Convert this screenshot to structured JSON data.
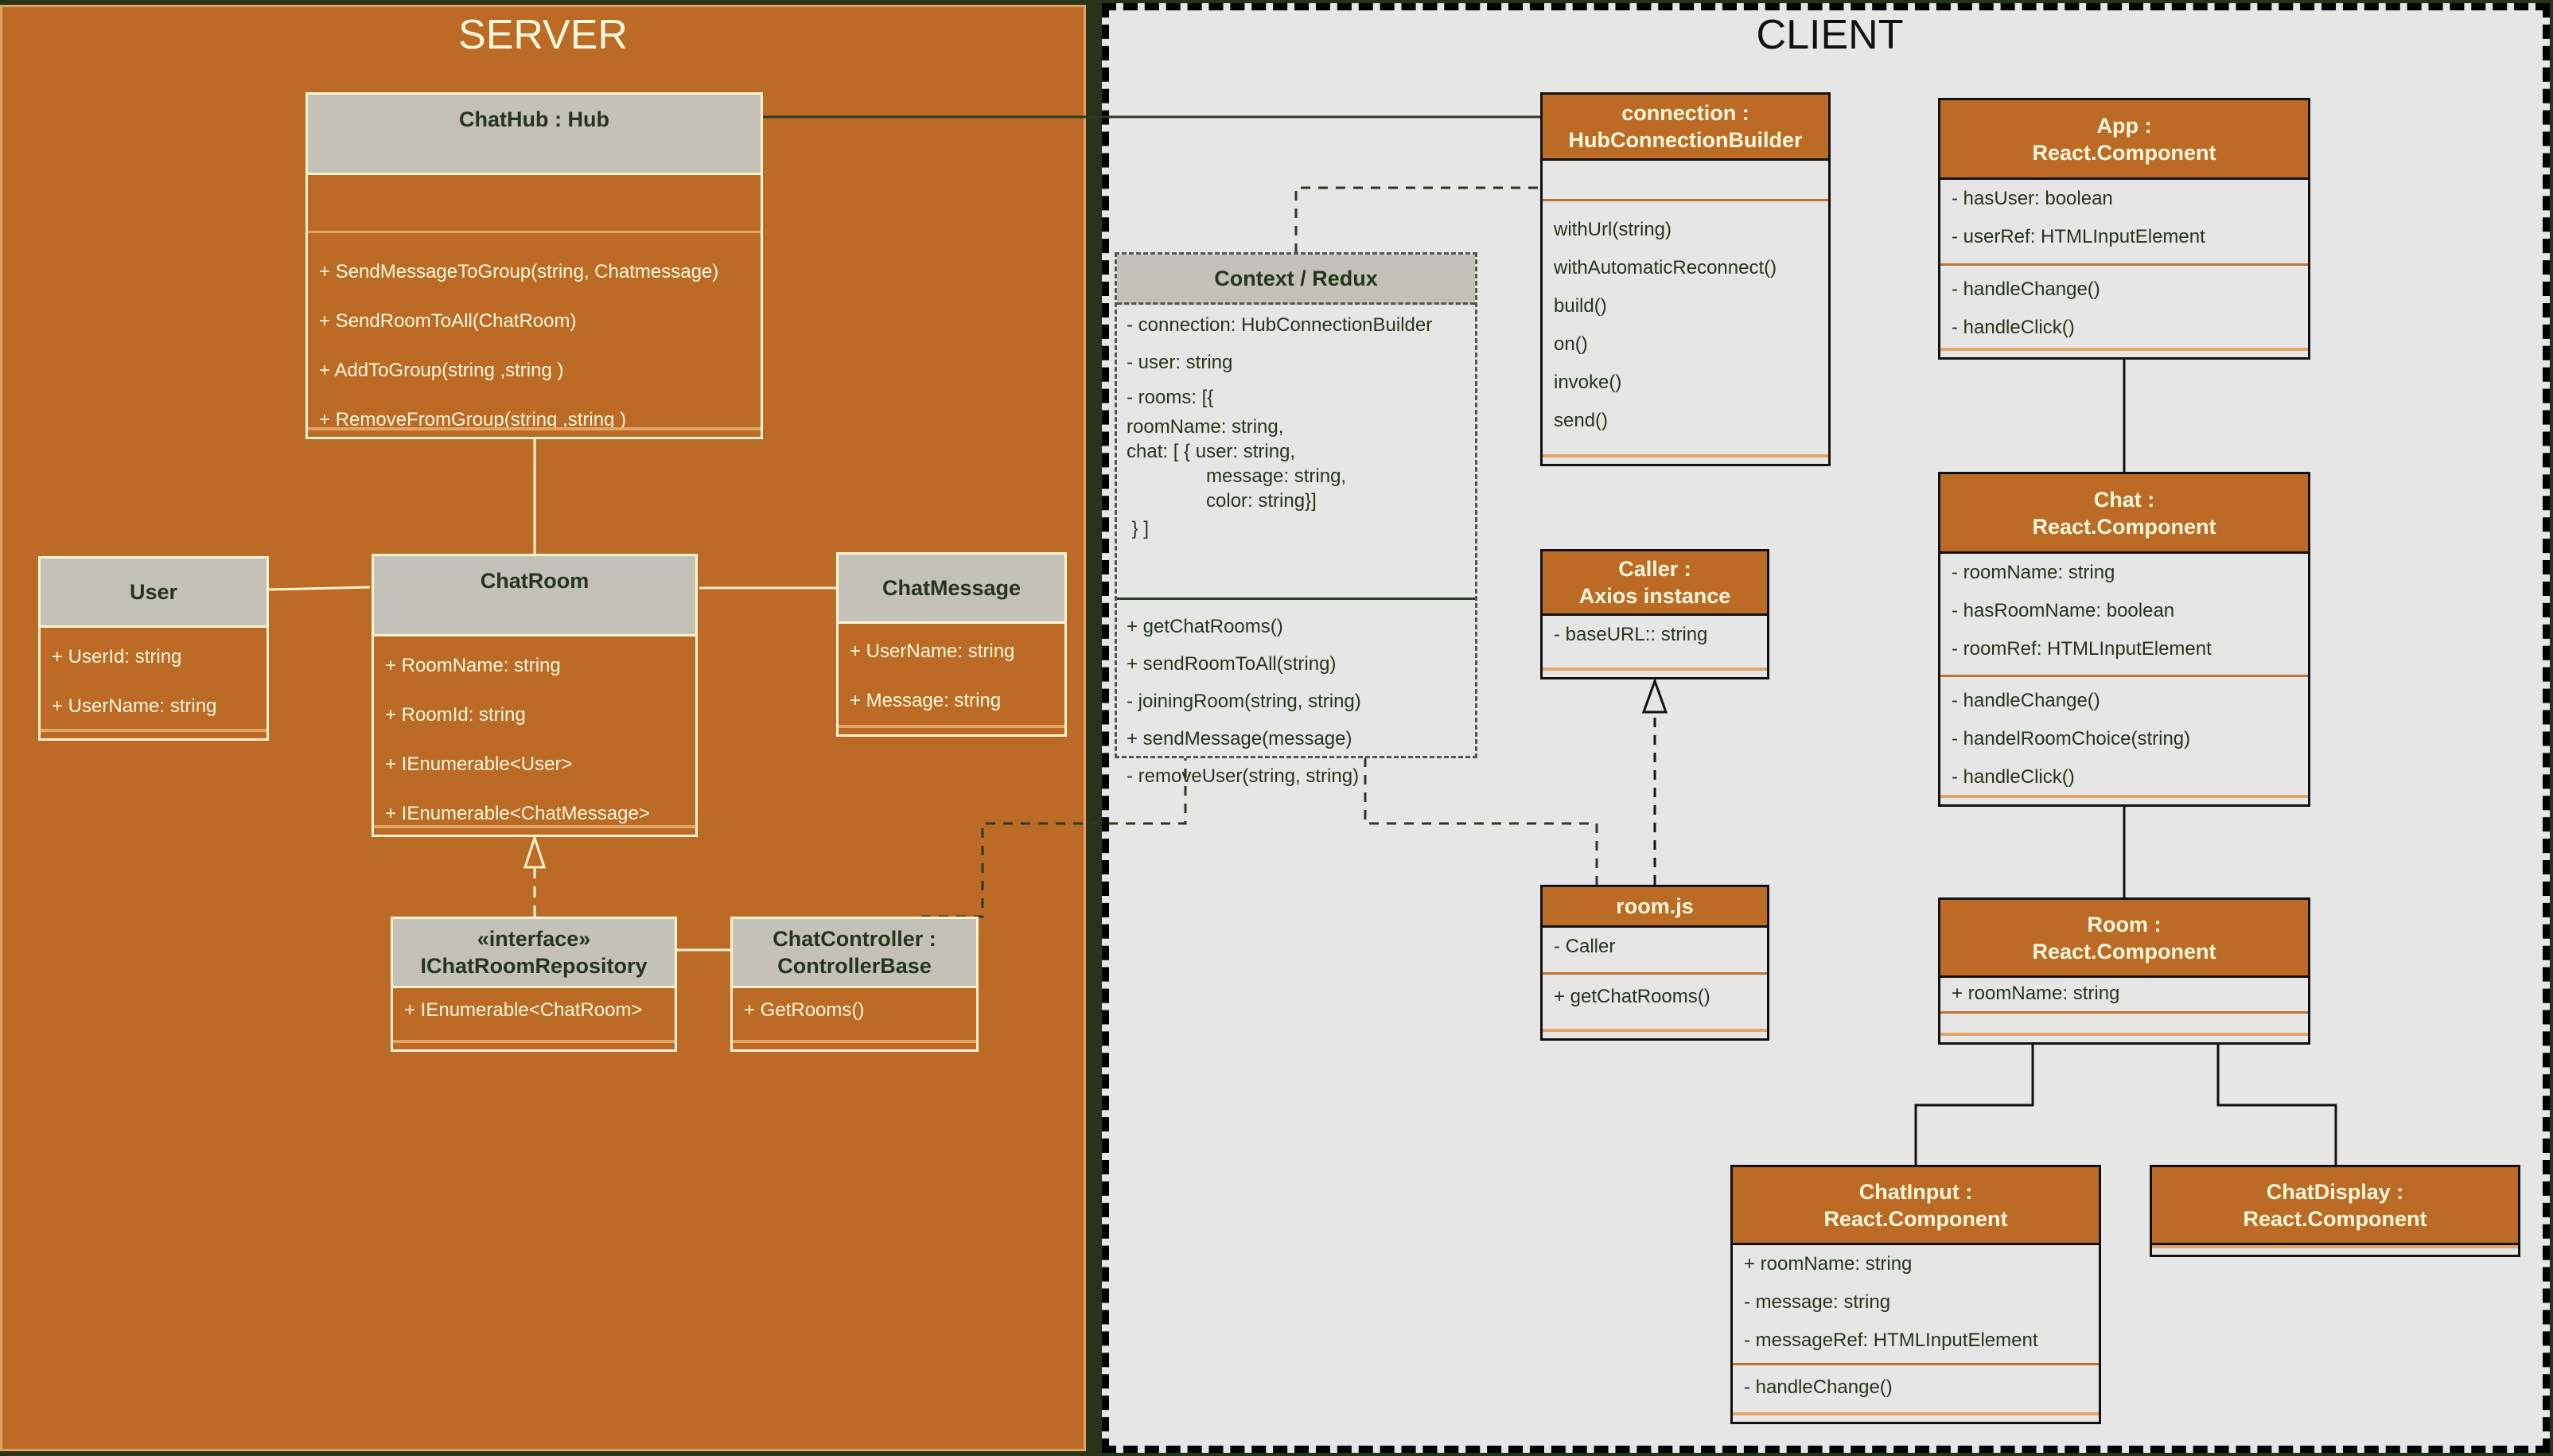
{
  "panels": {
    "server": {
      "title": "SERVER",
      "background": "#bb6b25"
    },
    "client": {
      "title": "CLIENT",
      "background": "#e6e6e6"
    }
  },
  "colors": {
    "accent_orange": "#bb6b25",
    "header_gray": "#c4c1b9",
    "text_dark": "#25351b",
    "text_cream": "#fff8dc",
    "frame": "#283419"
  },
  "server_classes": {
    "chathub": {
      "title": "ChatHub : Hub",
      "attributes": [],
      "methods": [
        "+ SendMessageToGroup(string, Chatmessage)",
        "+ SendRoomToAll(ChatRoom)",
        "+ AddToGroup(string ,string )",
        "+ RemoveFromGroup(string ,string )"
      ]
    },
    "user": {
      "title": "User",
      "attributes": [
        "+ UserId: string",
        "+ UserName: string"
      ]
    },
    "chatroom": {
      "title": "ChatRoom",
      "attributes": [
        "+ RoomName: string",
        "+ RoomId: string",
        "+ IEnumerable<User>",
        "+ IEnumerable<ChatMessage>"
      ]
    },
    "chatmessage": {
      "title": "ChatMessage",
      "attributes": [
        "+ UserName: string",
        "+ Message: string"
      ]
    },
    "ichatroomrepository": {
      "stereotype": "«interface»",
      "title": "IChatRoomRepository",
      "attributes": [
        "+ IEnumerable<ChatRoom>"
      ]
    },
    "chatcontroller": {
      "title_line1": "ChatController :",
      "title_line2": "ControllerBase",
      "attributes": [
        "+ GetRooms()"
      ]
    }
  },
  "client_classes": {
    "context": {
      "title": "Context / Redux",
      "attributes": [
        "- connection: HubConnectionBuilder",
        "- user: string",
        "- rooms: [{",
        "roomName: string,",
        "chat: [ { user: string,",
        "               message: string,",
        "               color: string}]",
        " } ]"
      ],
      "methods": [
        "+ getChatRooms()",
        "+ sendRoomToAll(string)",
        "- joiningRoom(string, string)",
        "+ sendMessage(message)",
        "- removeUser(string, string)"
      ]
    },
    "connection": {
      "title_line1": "connection :",
      "title_line2": "HubConnectionBuilder",
      "methods": [
        "withUrl(string)",
        "withAutomaticReconnect()",
        "build()",
        "on()",
        "invoke()",
        "send()"
      ]
    },
    "caller": {
      "title_line1": "Caller :",
      "title_line2": "Axios instance",
      "attributes": [
        "- baseURL:: string"
      ]
    },
    "roomjs": {
      "title": "room.js",
      "attributes": [
        "- Caller"
      ],
      "methods": [
        "+ getChatRooms()"
      ]
    },
    "app": {
      "title_line1": "App :",
      "title_line2": "React.Component",
      "attributes": [
        "- hasUser: boolean",
        "- userRef: HTMLInputElement"
      ],
      "methods": [
        "- handleChange()",
        "- handleClick()"
      ]
    },
    "chat": {
      "title_line1": "Chat  :",
      "title_line2": "React.Component",
      "attributes": [
        "- roomName: string",
        "- hasRoomName: boolean",
        "- roomRef: HTMLInputElement"
      ],
      "methods": [
        "- handleChange()",
        "- handelRoomChoice(string)",
        "- handleClick()"
      ]
    },
    "room": {
      "title_line1": "Room  :",
      "title_line2": "React.Component",
      "attributes": [
        "+ roomName: string"
      ]
    },
    "chatinput": {
      "title_line1": "ChatInput  :",
      "title_line2": "React.Component",
      "attributes": [
        "+ roomName: string",
        "- message: string",
        "- messageRef: HTMLInputElement"
      ],
      "methods": [
        "- handleChange()"
      ]
    },
    "chatdisplay": {
      "title_line1": "ChatDisplay  :",
      "title_line2": "React.Component"
    }
  }
}
